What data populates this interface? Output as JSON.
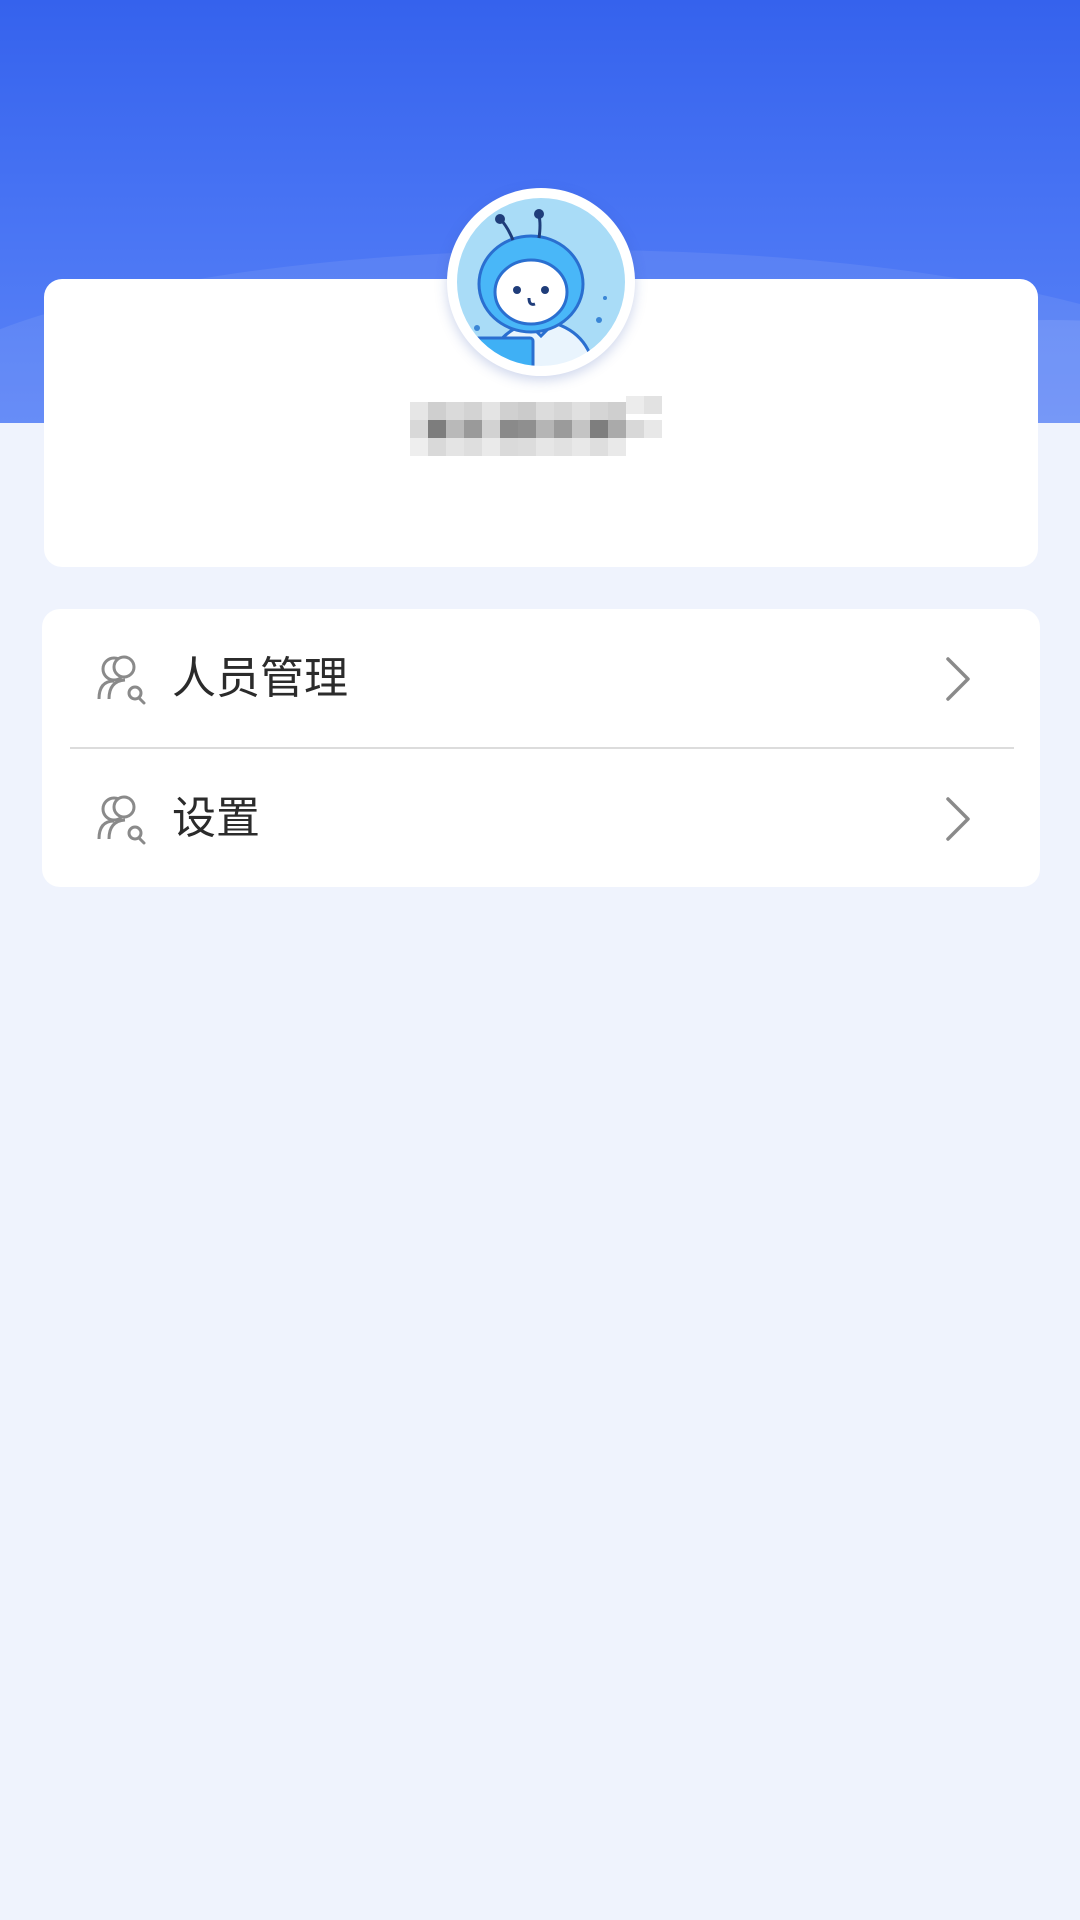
{
  "profile": {
    "avatar_icon": "cartoon-mascot-avatar",
    "username": ""
  },
  "menu": {
    "items": [
      {
        "label": "人员管理",
        "icon": "people-search-icon"
      },
      {
        "label": "设置",
        "icon": "people-search-icon"
      }
    ]
  },
  "colors": {
    "header_blue": "#3562ed",
    "page_background": "#eff3fd",
    "card_background": "#ffffff",
    "text_primary": "#2b2b2b",
    "icon_gray": "#8a8a8a"
  }
}
